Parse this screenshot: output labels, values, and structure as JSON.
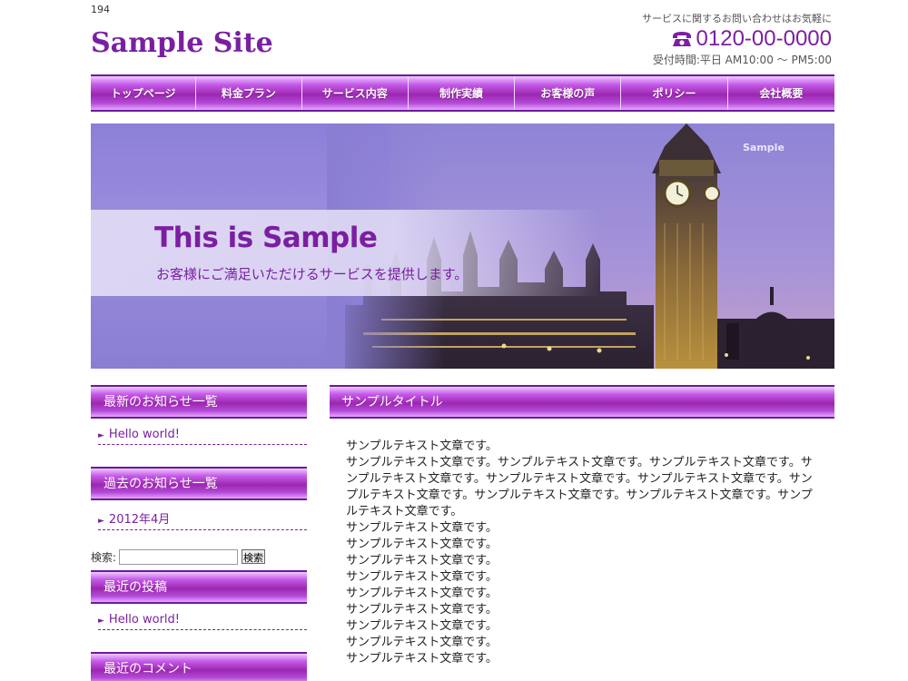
{
  "page_counter": "194",
  "header": {
    "logo": "Sample Site",
    "contact_lead": "サービスに関するお問い合わせはお気軽に",
    "phone": "0120-00-0000",
    "hours": "受付時間:平日 AM10:00 ～ PM5:00"
  },
  "nav": {
    "items": [
      "トップページ",
      "料金プラン",
      "サービス内容",
      "制作実績",
      "お客様の声",
      "ポリシー",
      "会社概要"
    ]
  },
  "hero": {
    "title": "This is Sample",
    "subtitle": "お客様にご満足いただけるサービスを提供します。",
    "watermark": "Sample"
  },
  "sidebar": {
    "widgets": [
      {
        "title": "最新のお知らせ一覧",
        "items": [
          "Hello world!"
        ]
      },
      {
        "title": "過去のお知らせ一覧",
        "items": [
          "2012年4月"
        ]
      },
      {
        "title": "最近の投稿",
        "items": [
          "Hello world!"
        ]
      },
      {
        "title": "最近のコメント",
        "items": []
      }
    ],
    "search": {
      "label": "検索:",
      "value": "",
      "button": "検索"
    }
  },
  "content": {
    "title": "サンプルタイトル",
    "paragraphs": [
      "サンプルテキスト文章です。",
      "サンプルテキスト文章です。サンプルテキスト文章です。サンプルテキスト文章です。サンプルテキスト文章です。サンプルテキスト文章です。サンプルテキスト文章です。サンプルテキスト文章です。サンプルテキスト文章です。サンプルテキスト文章です。サンプルテキスト文章です。",
      "サンプルテキスト文章です。",
      "サンプルテキスト文章です。",
      "サンプルテキスト文章です。",
      "サンプルテキスト文章です。",
      "サンプルテキスト文章です。",
      "サンプルテキスト文章です。",
      "サンプルテキスト文章です。",
      "サンプルテキスト文章です。",
      "サンプルテキスト文章です。"
    ]
  },
  "colors": {
    "accent": "#7b1fa2",
    "nav_dark": "#6a1b9a"
  },
  "icons": {
    "phone": "phone-icon",
    "bullet": "triangle-right-icon"
  }
}
